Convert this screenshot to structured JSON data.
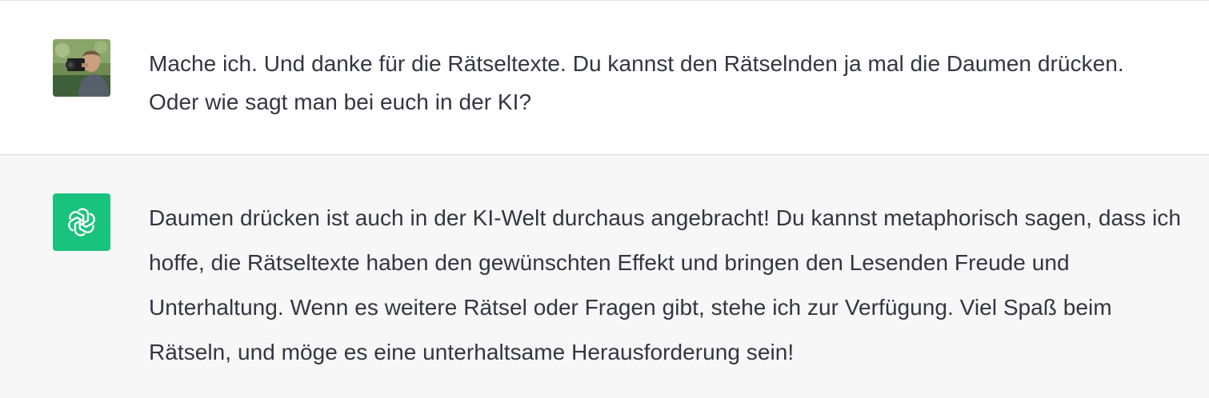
{
  "messages": {
    "user": {
      "text": "Mache ich. Und danke für die Rätseltexte. Du kannst den Rätselnden ja mal die Daumen drücken. Oder wie sagt man bei euch in der KI?"
    },
    "assistant": {
      "text": "Daumen drücken ist auch in der KI-Welt durchaus angebracht! Du kannst metaphorisch sagen, dass ich hoffe, die Rätseltexte haben den gewünschten Effekt und bringen den Lesenden Freude und Unterhaltung. Wenn es weitere Rätsel oder Fragen gibt, stehe ich zur Verfügung. Viel Spaß beim Rätseln, und möge es eine unterhaltsame Herausforderung sein!",
      "avatar_color": "#19c37d"
    }
  },
  "icons": {
    "user_avatar": "user-photo-avatar",
    "assistant_avatar": "openai-logo-icon"
  }
}
